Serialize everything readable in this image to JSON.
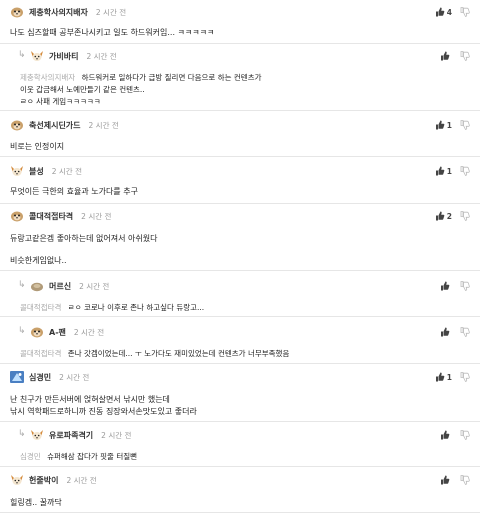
{
  "icons": {
    "upvote": "thumb-up-icon",
    "downvote": "thumb-down-icon",
    "reply_arrow": "reply-arrow-icon"
  },
  "comments": [
    {
      "nick": "제충학사의지배자",
      "time": "2 시간 전",
      "votes": "4",
      "lines": [
        "나도 심즈할때 공부존나시키고 일도 하드워커임... ㅋㅋㅋㅋㅋ"
      ]
    },
    {
      "nick": "가비바티",
      "time": "2 시간 전",
      "quote": "제충학사의지배자",
      "lines": [
        "하드워커로 일하다가 급방 질리면 다음으로 하는 컨텐츠가",
        "이웃 갑금해서 노예만들기 같은 컨텐츠..",
        "ㄹㅇ 사패 게임ㅋㅋㅋㅋㅋ"
      ]
    },
    {
      "nick": "축선제시딘가드",
      "time": "2 시간 전",
      "votes": "1",
      "lines": [
        "비로는 인정이지"
      ]
    },
    {
      "nick": "블성",
      "time": "2 시간 전",
      "votes": "1",
      "lines": [
        "무엇이든 극한의 효율과 노가다를 추구"
      ]
    },
    {
      "nick": "콜대적접타격",
      "time": "2 시간 전",
      "votes": "2",
      "lines": [
        "듀랑고같은겜 좋아하는데 없어져서 아쉬웠다",
        "비슷한게임없나.."
      ]
    },
    {
      "nick": "머르신",
      "time": "2 시간 전",
      "quote": "콜대적접타격",
      "lines": [
        "ㄹㅇ 코로나 이후로 존나 하고싶다 듀랑고..."
      ]
    },
    {
      "nick": "A-팬",
      "time": "2 시간 전",
      "quote": "콜대적접타격",
      "lines": [
        "존나 갓겜이었는데... ㅜ 노가다도 재미있었는데 컨텐츠가 너무부족했음"
      ]
    },
    {
      "nick": "심경민",
      "time": "2 시간 전",
      "votes": "1",
      "lines": [
        "난 친구가 만든서버에 얹혀살면서 낚시만 했는데",
        "낚시 역학패드로하니까 진동 징장와서손맛도있고 좋더라"
      ]
    },
    {
      "nick": "유로파족격기",
      "time": "2 시간 전",
      "quote": "심경민",
      "lines": [
        "슈퍼해삼 잡다가 핏줄 터질뻔"
      ]
    },
    {
      "nick": "헌줄박이",
      "time": "2 시간 전",
      "lines": [
        "힐링겜.. 꿀까닥"
      ]
    }
  ]
}
